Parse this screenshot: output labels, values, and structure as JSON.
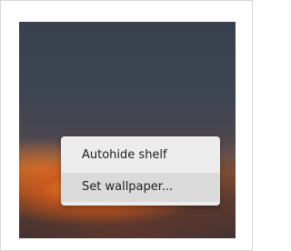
{
  "context_menu": {
    "items": [
      {
        "label": "Autohide shelf"
      },
      {
        "label": "Set wallpaper..."
      }
    ],
    "highlighted_index": 1
  }
}
